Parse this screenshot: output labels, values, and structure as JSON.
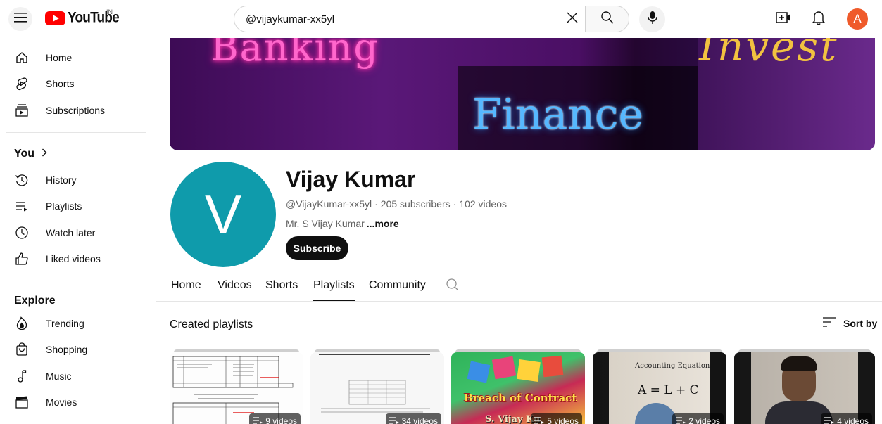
{
  "topbar": {
    "logo_text": "YouTube",
    "country_code": "IN",
    "search_value": "@vijaykumar-xx5yl",
    "avatar_letter": "A"
  },
  "sidebar": {
    "main_items": [
      {
        "label": "Home",
        "icon": "home-icon"
      },
      {
        "label": "Shorts",
        "icon": "shorts-icon"
      },
      {
        "label": "Subscriptions",
        "icon": "subscriptions-icon"
      }
    ],
    "you_heading": "You",
    "you_items": [
      {
        "label": "History",
        "icon": "history-icon"
      },
      {
        "label": "Playlists",
        "icon": "playlists-icon"
      },
      {
        "label": "Watch later",
        "icon": "watch-later-icon"
      },
      {
        "label": "Liked videos",
        "icon": "liked-icon"
      }
    ],
    "explore_heading": "Explore",
    "explore_items": [
      {
        "label": "Trending",
        "icon": "trending-icon"
      },
      {
        "label": "Shopping",
        "icon": "shopping-icon"
      },
      {
        "label": "Music",
        "icon": "music-icon"
      },
      {
        "label": "Movies",
        "icon": "movies-icon"
      }
    ]
  },
  "banner": {
    "text_left": "Banking",
    "text_center": "Finance",
    "text_right": "Invest"
  },
  "channel": {
    "avatar_letter": "V",
    "name": "Vijay Kumar",
    "handle": "@VijayKumar-xx5yl",
    "subscribers": "205 subscribers",
    "videos": "102 videos",
    "separator": "·",
    "description": "Mr. S Vijay Kumar",
    "more_label": "...more",
    "subscribe_label": "Subscribe",
    "avatar_color": "#0f9bab"
  },
  "tabs": [
    {
      "label": "Home"
    },
    {
      "label": "Videos"
    },
    {
      "label": "Shorts"
    },
    {
      "label": "Playlists",
      "active": true
    },
    {
      "label": "Community"
    }
  ],
  "section": {
    "title": "Created playlists",
    "sort_label": "Sort by"
  },
  "playlists": [
    {
      "count": "9 videos"
    },
    {
      "count": "34 videos"
    },
    {
      "count": "5 videos",
      "thumb_text": "Breach of Contract",
      "thumb_text2": "S. Vijay Ku"
    },
    {
      "count": "2 videos",
      "thumb_text": "Accounting Equation",
      "thumb_text2": "A = L + C"
    },
    {
      "count": "4 videos"
    }
  ],
  "colors": {
    "brand_red": "#ff0000",
    "account_avatar": "#ef5a2a",
    "subscribe_bg": "#0f0f0f"
  }
}
